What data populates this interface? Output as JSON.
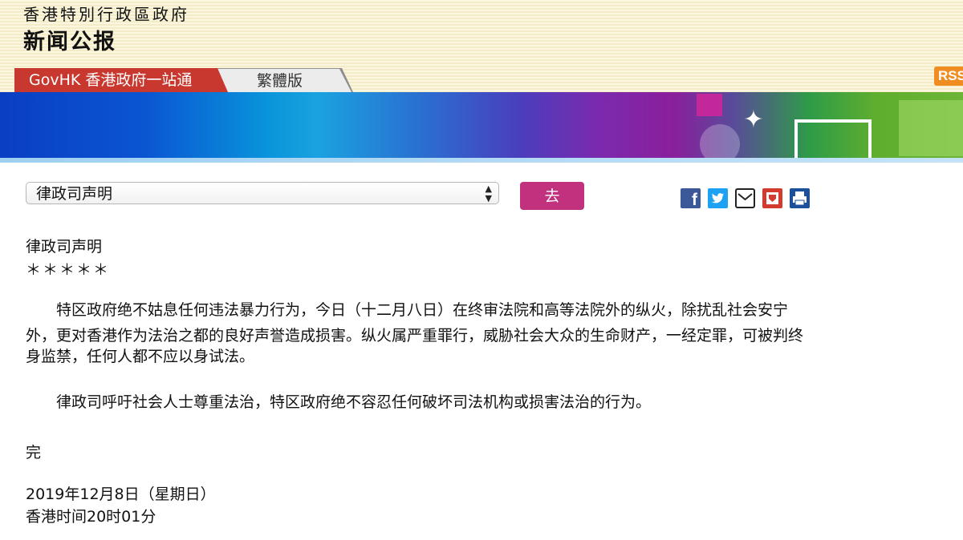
{
  "header": {
    "org_title": "香港特別行政區政府",
    "bulletin_title": "新闻公报",
    "tab_govhk": "GovHK 香港政府一站通",
    "tab_traditional": "繁體版",
    "rss_label": "RSS"
  },
  "toolbar": {
    "select_value": "律政司声明",
    "go_label": "去",
    "share_icons": [
      "facebook-icon",
      "twitter-icon",
      "email-icon",
      "bookmark-icon",
      "print-icon"
    ]
  },
  "article": {
    "title": "律政司声明",
    "stars": "＊＊＊＊＊",
    "para1_line1": "　　特区政府绝不姑息任何违法暴力行为，今日（十二月八日）在终审法院和高等法院外的纵火，除扰乱社会安宁",
    "para1_line2": "外，更对香港作为法治之都的良好声誉造成损害。纵火属严重罪行，威胁社会大众的生命财产，一经定罪，可被判终",
    "para1_line3": "身监禁，任何人都不应以身试法。",
    "para2": "　　律政司呼吁社会人士尊重法治，特区政府绝不容忍任何破坏司法机构或损害法治的行为。",
    "end": "完",
    "date": "2019年12月8日（星期日）",
    "time": "香港时间20时01分"
  },
  "colors": {
    "govhk_tab": "#c8382e",
    "go_button": "#c2317e",
    "rss": "#f08d22"
  }
}
